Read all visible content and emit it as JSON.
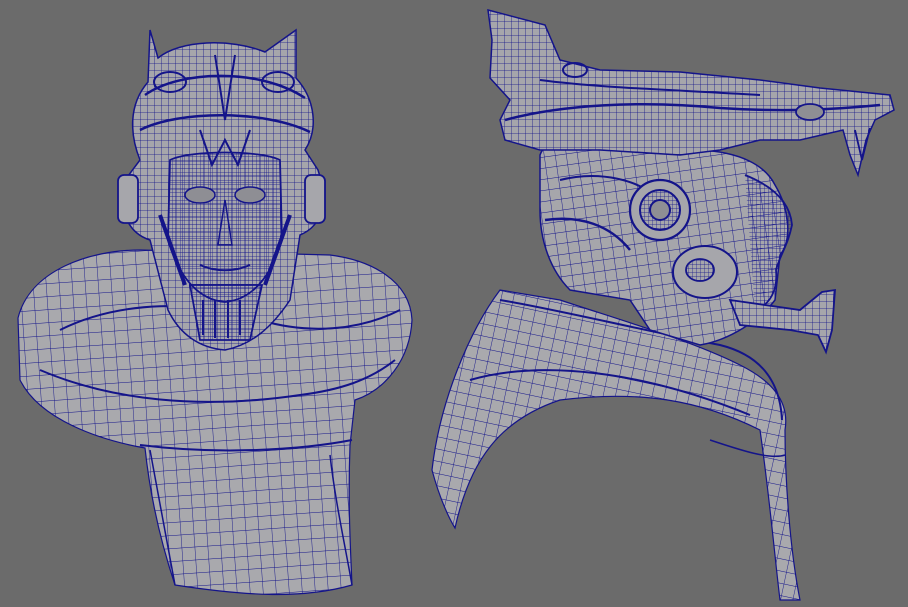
{
  "scene": {
    "background_color": "#6b6b6b",
    "surface_color": "#a9a9ad",
    "surface_shadow_color": "#8e8e94",
    "wire_color": "#14148a",
    "objects": [
      {
        "name": "front-view-bust",
        "view": "front"
      },
      {
        "name": "side-view-bust",
        "view": "side"
      }
    ]
  }
}
